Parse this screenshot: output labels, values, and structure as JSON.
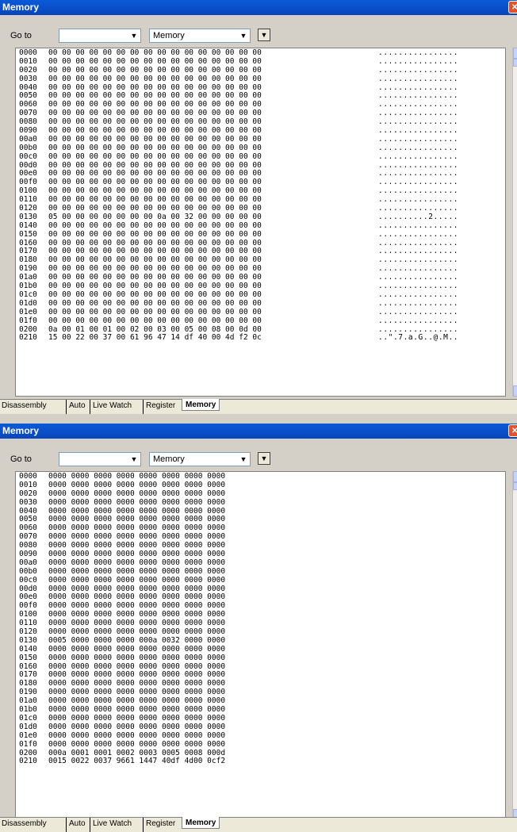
{
  "panel1": {
    "title": "Memory",
    "close_glyph": "✕",
    "goto_label": "Go to",
    "goto_value": "",
    "memory_select": "Memory",
    "rows": [
      {
        "addr": "0000",
        "hex": "00 00 00 00 00 00 00 00 00 00 00 00 00 00 00 00",
        "ascii": "................"
      },
      {
        "addr": "0010",
        "hex": "00 00 00 00 00 00 00 00 00 00 00 00 00 00 00 00",
        "ascii": "................"
      },
      {
        "addr": "0020",
        "hex": "00 00 00 00 00 00 00 00 00 00 00 00 00 00 00 00",
        "ascii": "................"
      },
      {
        "addr": "0030",
        "hex": "00 00 00 00 00 00 00 00 00 00 00 00 00 00 00 00",
        "ascii": "................"
      },
      {
        "addr": "0040",
        "hex": "00 00 00 00 00 00 00 00 00 00 00 00 00 00 00 00",
        "ascii": "................"
      },
      {
        "addr": "0050",
        "hex": "00 00 00 00 00 00 00 00 00 00 00 00 00 00 00 00",
        "ascii": "................"
      },
      {
        "addr": "0060",
        "hex": "00 00 00 00 00 00 00 00 00 00 00 00 00 00 00 00",
        "ascii": "................"
      },
      {
        "addr": "0070",
        "hex": "00 00 00 00 00 00 00 00 00 00 00 00 00 00 00 00",
        "ascii": "................"
      },
      {
        "addr": "0080",
        "hex": "00 00 00 00 00 00 00 00 00 00 00 00 00 00 00 00",
        "ascii": "................"
      },
      {
        "addr": "0090",
        "hex": "00 00 00 00 00 00 00 00 00 00 00 00 00 00 00 00",
        "ascii": "................"
      },
      {
        "addr": "00a0",
        "hex": "00 00 00 00 00 00 00 00 00 00 00 00 00 00 00 00",
        "ascii": "................"
      },
      {
        "addr": "00b0",
        "hex": "00 00 00 00 00 00 00 00 00 00 00 00 00 00 00 00",
        "ascii": "................"
      },
      {
        "addr": "00c0",
        "hex": "00 00 00 00 00 00 00 00 00 00 00 00 00 00 00 00",
        "ascii": "................"
      },
      {
        "addr": "00d0",
        "hex": "00 00 00 00 00 00 00 00 00 00 00 00 00 00 00 00",
        "ascii": "................"
      },
      {
        "addr": "00e0",
        "hex": "00 00 00 00 00 00 00 00 00 00 00 00 00 00 00 00",
        "ascii": "................"
      },
      {
        "addr": "00f0",
        "hex": "00 00 00 00 00 00 00 00 00 00 00 00 00 00 00 00",
        "ascii": "................"
      },
      {
        "addr": "0100",
        "hex": "00 00 00 00 00 00 00 00 00 00 00 00 00 00 00 00",
        "ascii": "................"
      },
      {
        "addr": "0110",
        "hex": "00 00 00 00 00 00 00 00 00 00 00 00 00 00 00 00",
        "ascii": "................"
      },
      {
        "addr": "0120",
        "hex": "00 00 00 00 00 00 00 00 00 00 00 00 00 00 00 00",
        "ascii": "................"
      },
      {
        "addr": "0130",
        "hex": "05 00 00 00 00 00 00 00 0a 00 32 00 00 00 00 00",
        "ascii": "..........2....."
      },
      {
        "addr": "0140",
        "hex": "00 00 00 00 00 00 00 00 00 00 00 00 00 00 00 00",
        "ascii": "................"
      },
      {
        "addr": "0150",
        "hex": "00 00 00 00 00 00 00 00 00 00 00 00 00 00 00 00",
        "ascii": "................"
      },
      {
        "addr": "0160",
        "hex": "00 00 00 00 00 00 00 00 00 00 00 00 00 00 00 00",
        "ascii": "................"
      },
      {
        "addr": "0170",
        "hex": "00 00 00 00 00 00 00 00 00 00 00 00 00 00 00 00",
        "ascii": "................"
      },
      {
        "addr": "0180",
        "hex": "00 00 00 00 00 00 00 00 00 00 00 00 00 00 00 00",
        "ascii": "................"
      },
      {
        "addr": "0190",
        "hex": "00 00 00 00 00 00 00 00 00 00 00 00 00 00 00 00",
        "ascii": "................"
      },
      {
        "addr": "01a0",
        "hex": "00 00 00 00 00 00 00 00 00 00 00 00 00 00 00 00",
        "ascii": "................"
      },
      {
        "addr": "01b0",
        "hex": "00 00 00 00 00 00 00 00 00 00 00 00 00 00 00 00",
        "ascii": "................"
      },
      {
        "addr": "01c0",
        "hex": "00 00 00 00 00 00 00 00 00 00 00 00 00 00 00 00",
        "ascii": "................"
      },
      {
        "addr": "01d0",
        "hex": "00 00 00 00 00 00 00 00 00 00 00 00 00 00 00 00",
        "ascii": "................"
      },
      {
        "addr": "01e0",
        "hex": "00 00 00 00 00 00 00 00 00 00 00 00 00 00 00 00",
        "ascii": "................"
      },
      {
        "addr": "01f0",
        "hex": "00 00 00 00 00 00 00 00 00 00 00 00 00 00 00 00",
        "ascii": "................"
      },
      {
        "addr": "0200",
        "hex": "0a 00 01 00 01 00 02 00 03 00 05 00 08 00 0d 00",
        "ascii": "................"
      },
      {
        "addr": "0210",
        "hex": "15 00 22 00 37 00 61 96 47 14 df 40 00 4d f2 0c",
        "ascii": "..\".7.a.G..@.M.."
      }
    ],
    "tabs": [
      "Disassembly",
      "Auto",
      "Live Watch",
      "Register",
      "Memory"
    ]
  },
  "panel2": {
    "title": "Memory",
    "close_glyph": "✕",
    "goto_label": "Go to",
    "goto_value": "",
    "memory_select": "Memory",
    "rows": [
      {
        "addr": "0000",
        "hex": "0000 0000 0000 0000 0000 0000 0000 0000"
      },
      {
        "addr": "0010",
        "hex": "0000 0000 0000 0000 0000 0000 0000 0000"
      },
      {
        "addr": "0020",
        "hex": "0000 0000 0000 0000 0000 0000 0000 0000"
      },
      {
        "addr": "0030",
        "hex": "0000 0000 0000 0000 0000 0000 0000 0000"
      },
      {
        "addr": "0040",
        "hex": "0000 0000 0000 0000 0000 0000 0000 0000"
      },
      {
        "addr": "0050",
        "hex": "0000 0000 0000 0000 0000 0000 0000 0000"
      },
      {
        "addr": "0060",
        "hex": "0000 0000 0000 0000 0000 0000 0000 0000"
      },
      {
        "addr": "0070",
        "hex": "0000 0000 0000 0000 0000 0000 0000 0000"
      },
      {
        "addr": "0080",
        "hex": "0000 0000 0000 0000 0000 0000 0000 0000"
      },
      {
        "addr": "0090",
        "hex": "0000 0000 0000 0000 0000 0000 0000 0000"
      },
      {
        "addr": "00a0",
        "hex": "0000 0000 0000 0000 0000 0000 0000 0000"
      },
      {
        "addr": "00b0",
        "hex": "0000 0000 0000 0000 0000 0000 0000 0000"
      },
      {
        "addr": "00c0",
        "hex": "0000 0000 0000 0000 0000 0000 0000 0000"
      },
      {
        "addr": "00d0",
        "hex": "0000 0000 0000 0000 0000 0000 0000 0000"
      },
      {
        "addr": "00e0",
        "hex": "0000 0000 0000 0000 0000 0000 0000 0000"
      },
      {
        "addr": "00f0",
        "hex": "0000 0000 0000 0000 0000 0000 0000 0000"
      },
      {
        "addr": "0100",
        "hex": "0000 0000 0000 0000 0000 0000 0000 0000"
      },
      {
        "addr": "0110",
        "hex": "0000 0000 0000 0000 0000 0000 0000 0000"
      },
      {
        "addr": "0120",
        "hex": "0000 0000 0000 0000 0000 0000 0000 0000"
      },
      {
        "addr": "0130",
        "hex": "0005 0000 0000 0000 000a 0032 0000 0000"
      },
      {
        "addr": "0140",
        "hex": "0000 0000 0000 0000 0000 0000 0000 0000"
      },
      {
        "addr": "0150",
        "hex": "0000 0000 0000 0000 0000 0000 0000 0000"
      },
      {
        "addr": "0160",
        "hex": "0000 0000 0000 0000 0000 0000 0000 0000"
      },
      {
        "addr": "0170",
        "hex": "0000 0000 0000 0000 0000 0000 0000 0000"
      },
      {
        "addr": "0180",
        "hex": "0000 0000 0000 0000 0000 0000 0000 0000"
      },
      {
        "addr": "0190",
        "hex": "0000 0000 0000 0000 0000 0000 0000 0000"
      },
      {
        "addr": "01a0",
        "hex": "0000 0000 0000 0000 0000 0000 0000 0000"
      },
      {
        "addr": "01b0",
        "hex": "0000 0000 0000 0000 0000 0000 0000 0000"
      },
      {
        "addr": "01c0",
        "hex": "0000 0000 0000 0000 0000 0000 0000 0000"
      },
      {
        "addr": "01d0",
        "hex": "0000 0000 0000 0000 0000 0000 0000 0000"
      },
      {
        "addr": "01e0",
        "hex": "0000 0000 0000 0000 0000 0000 0000 0000"
      },
      {
        "addr": "01f0",
        "hex": "0000 0000 0000 0000 0000 0000 0000 0000"
      },
      {
        "addr": "0200",
        "hex": "000a 0001 0001 0002 0003 0005 0008 000d"
      },
      {
        "addr": "0210",
        "hex": "0015 0022 0037 9661 1447 40df 4d00 0cf2"
      }
    ],
    "tabs": [
      "Disassembly",
      "Auto",
      "Live Watch",
      "Register",
      "Memory"
    ]
  },
  "icons": {
    "dropdown": "▼",
    "scroll_up": "▲",
    "scroll_down": "▼"
  },
  "colors": {
    "titlebar": "#0a4fcc",
    "close": "#e0532b",
    "face": "#d4d0c8"
  }
}
